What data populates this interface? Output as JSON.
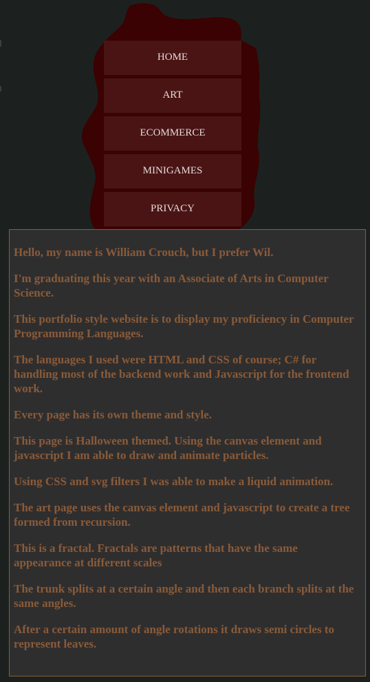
{
  "nav": {
    "items": [
      {
        "label": "HOME"
      },
      {
        "label": "ART"
      },
      {
        "label": "ECOMMERCE"
      },
      {
        "label": "MINIGAMES"
      },
      {
        "label": "PRIVACY"
      }
    ]
  },
  "content": {
    "paragraphs": [
      "Hello, my name is William Crouch, but I prefer Wil.",
      "I'm graduating this year with an Associate of Arts in Computer Science.",
      "This portfolio style website is to display my proficiency in Computer Programming Languages.",
      "The languages I used were HTML and CSS of course; C# for handling most of the backend work and Javascript for the frontend work.",
      "Every page has its own theme and style.",
      "This page is Halloween themed. Using the canvas element and javascript I am able to draw and animate particles.",
      "Using CSS and svg filters I was able to make a liquid animation.",
      "The art page uses the canvas element and javascript to create a tree formed from recursion.",
      "This is a fractal. Fractals are patterns that have the same appearance at different scales",
      "The trunk splits at a certain angle and then each branch splits at the same angles.",
      "After a certain amount of angle rotations it draws semi circles to represent leaves."
    ]
  },
  "theme": {
    "background": "#1c211f",
    "blob_color": "#3a0202",
    "nav_button_bg": "#4a1414",
    "nav_text": "#e6dada",
    "content_bg": "#2f2e2f",
    "content_border": "#8a5e35",
    "content_text": "#8a5b38"
  }
}
